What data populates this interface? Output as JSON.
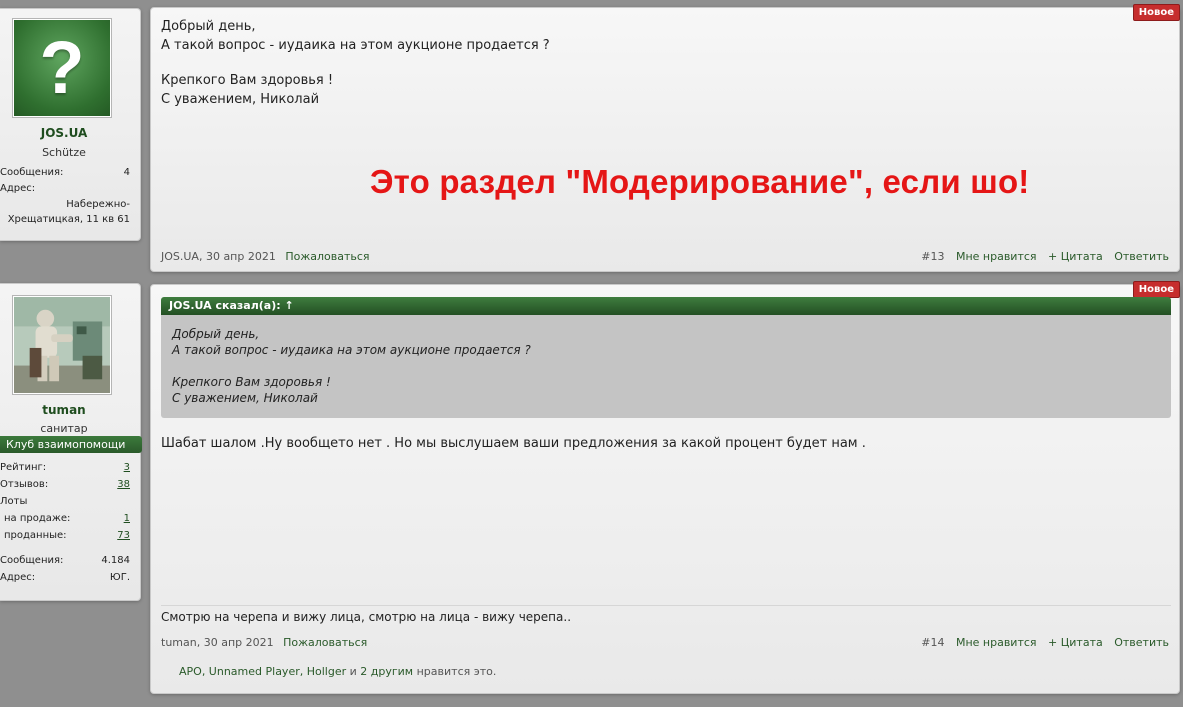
{
  "posts": [
    {
      "user": {
        "name": "JOS.UA",
        "title": "Schütze",
        "stats": [
          {
            "label": "Сообщения:",
            "value": "4"
          },
          {
            "label": "Адрес:",
            "value": ""
          }
        ],
        "address_lines": [
          "Набережно-",
          "Хрещатицкая, 11 кв 61"
        ]
      },
      "badge": "Новое",
      "message_lines": [
        "Добрый день,",
        "А такой вопрос - иудаика на этом аукционе продается ?",
        "",
        "Крепкого Вам здоровья !",
        "С уважением, Николай"
      ],
      "overlay_text": "Это раздел \"Модерирование\", если шо!",
      "footer": {
        "author_date": "JOS.UA, 30 апр 2021",
        "report": "Пожаловаться",
        "number": "#13",
        "like": "Мне нравится",
        "quote": "+ Цитата",
        "reply": "Ответить"
      }
    },
    {
      "user": {
        "name": "tuman",
        "title": "санитар",
        "club": "Клуб взаимопомощи",
        "stats": [
          {
            "label": "Рейтинг:",
            "value": "3"
          },
          {
            "label": "Отзывов:",
            "value": "38"
          },
          {
            "label": "Лоты",
            "value": ""
          },
          {
            "label": " на продаже:",
            "value": "1"
          },
          {
            "label": " проданные:",
            "value": "73"
          },
          {
            "label": "Сообщения:",
            "value": "4.184"
          },
          {
            "label": "Адрес:",
            "value": "ЮГ."
          }
        ]
      },
      "badge": "Новое",
      "quote": {
        "header": "JOS.UA сказал(а): ↑",
        "lines": [
          "Добрый день,",
          "А такой вопрос - иудаика на этом аукционе продается ?",
          "",
          "Крепкого Вам здоровья !",
          "С уважением, Николай"
        ]
      },
      "message": "Шабат шалом .Ну вообщето нет . Но мы выслушаем ваши предложения за какой процент будет нам .",
      "signature": "Смотрю на черепа и вижу лица, смотрю на лица - вижу черепа..",
      "footer": {
        "author_date": "tuman, 30 апр 2021",
        "report": "Пожаловаться",
        "number": "#14",
        "like": "Мне нравится",
        "quote": "+ Цитата",
        "reply": "Ответить"
      },
      "likes": {
        "names": "APO, Unnamed Player, Hollger",
        "connector": "и",
        "others": "2 другим",
        "suffix": "нравится это."
      }
    }
  ]
}
